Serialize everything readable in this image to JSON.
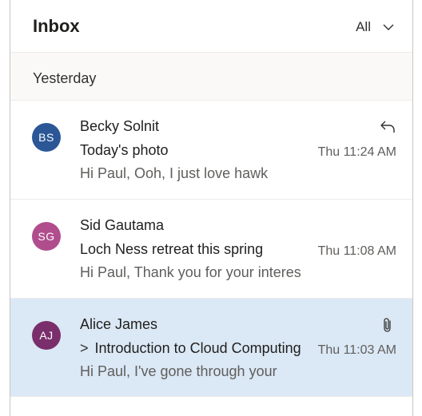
{
  "header": {
    "title": "Inbox",
    "filter_label": "All",
    "filter_icon": "chevron-down-icon"
  },
  "group": {
    "label": "Yesterday"
  },
  "messages": [
    {
      "initials": "BS",
      "avatar_color": "#2b5797",
      "sender": "Becky Solnit",
      "subject": "Today's photo",
      "time": "Thu 11:24 AM",
      "preview": "Hi Paul, Ooh, I just love hawk",
      "status_icon": "reply-icon",
      "selected": false
    },
    {
      "initials": "SG",
      "avatar_color": "#b04d8d",
      "sender": "Sid Gautama",
      "subject": "Loch Ness retreat this spring",
      "time": "Thu 11:08 AM",
      "preview": "Hi Paul, Thank you for your interest",
      "selected": false
    },
    {
      "initials": "AJ",
      "avatar_color": "#7a2e6b",
      "sender": "Alice James",
      "subject_prefix": ">",
      "subject": "Introduction to Cloud Computing",
      "time": "Thu 11:03 AM",
      "preview": "Hi Paul, I've gone through your",
      "status_icon": "paperclip-icon",
      "selected": true
    }
  ],
  "colors": {
    "selected_background": "#dbe8f5",
    "group_background": "#faf9f8"
  }
}
